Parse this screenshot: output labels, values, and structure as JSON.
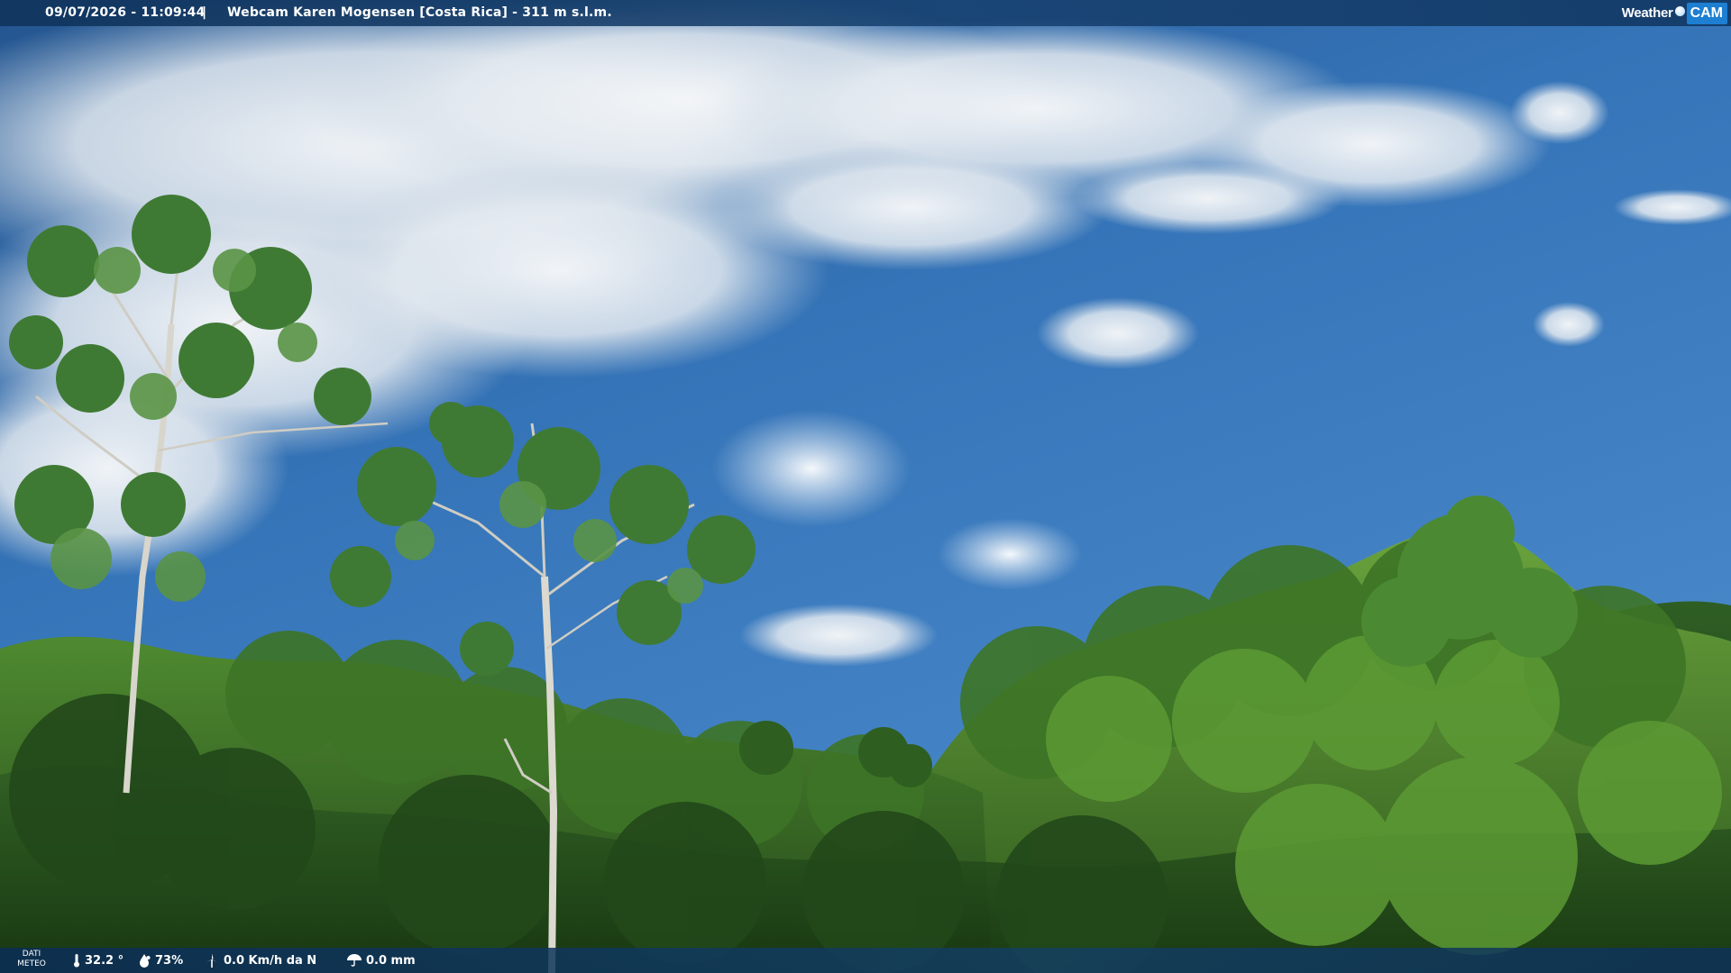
{
  "header": {
    "datetime": "09/07/2026 - 11:09:44",
    "separator": "|",
    "camera_title": "Webcam Karen Mogensen [Costa Rica] - 311 m s.l.m."
  },
  "brand": {
    "weather_text": "Weather",
    "cam_text": "CAM",
    "icon": "globe-dot-icon",
    "accent_color": "#1d7fd1"
  },
  "weather_panel": {
    "label_line1": "DATI",
    "label_line2": "METEO",
    "temperature": "32.2 °",
    "temperature_icon": "thermometer-icon",
    "humidity": "73%",
    "humidity_icon": "humidity-drop-icon",
    "wind": "0.0 Km/h da N",
    "wind_icon": "wind-turbine-icon",
    "rain": "0.0 mm",
    "rain_icon": "umbrella-icon"
  },
  "scene": {
    "description_colors": {
      "sky_top": "#2f67a8",
      "sky_bottom": "#3f7bc0",
      "forest_dark": "#1f4a1a",
      "forest_light": "#4d8a2e"
    }
  }
}
